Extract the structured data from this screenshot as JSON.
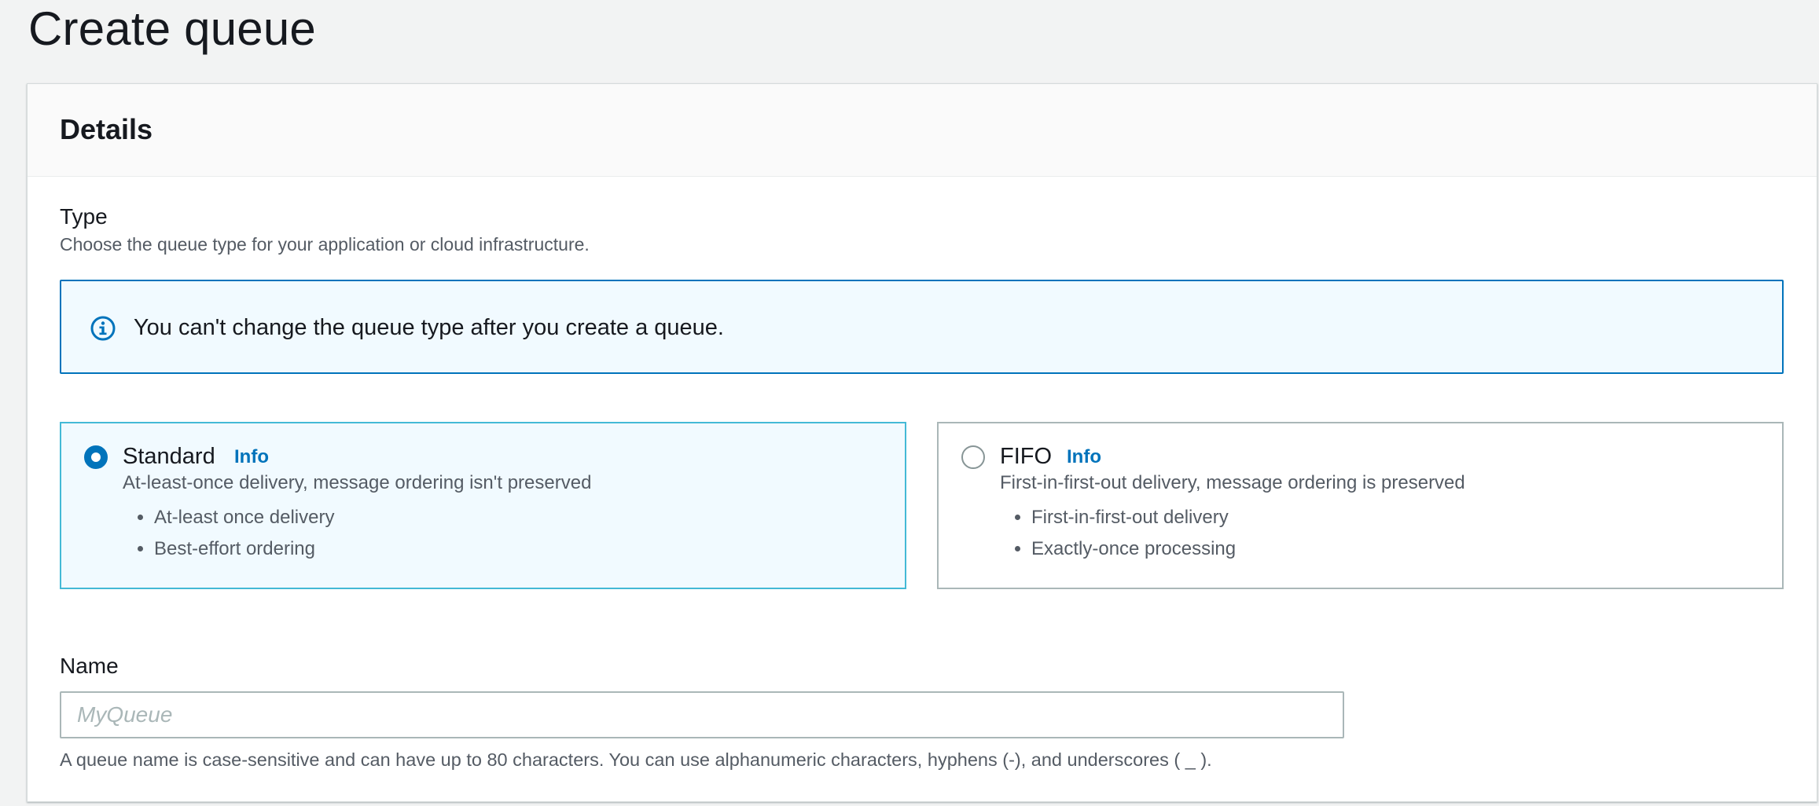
{
  "page": {
    "title": "Create queue"
  },
  "details": {
    "title": "Details",
    "type": {
      "label": "Type",
      "description": "Choose the queue type for your application or cloud infrastructure.",
      "alert": "You can't change the queue type after you create a queue.",
      "options": [
        {
          "title": "Standard",
          "info": "Info",
          "description": "At-least-once delivery, message ordering isn't preserved",
          "bullets": [
            "At-least once delivery",
            "Best-effort ordering"
          ],
          "selected": true
        },
        {
          "title": "FIFO",
          "info": "Info",
          "description": "First-in-first-out delivery, message ordering is preserved",
          "bullets": [
            "First-in-first-out delivery",
            "Exactly-once processing"
          ],
          "selected": false
        }
      ]
    },
    "name": {
      "label": "Name",
      "value": "",
      "placeholder": "MyQueue",
      "constraint": "A queue name is case-sensitive and can have up to 80 characters. You can use alphanumeric characters, hyphens (-), and underscores ( _ )."
    }
  },
  "colors": {
    "accent": "#0073bb",
    "selected_tile_bg": "#f1faff",
    "selected_tile_border": "#44b9d6",
    "page_bg": "#f2f3f3"
  },
  "icons": {
    "alert": "info-circle-icon"
  }
}
